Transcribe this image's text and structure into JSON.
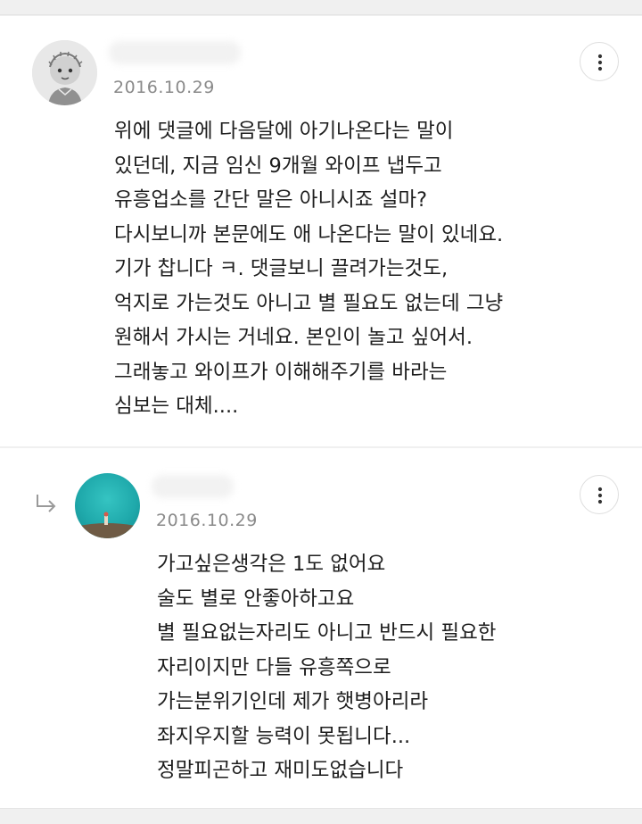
{
  "comments": [
    {
      "date": "2016.10.29",
      "avatar_icon": "character-sketch-avatar-icon",
      "menu_icon": "more-vertical-icon",
      "text": "위에 댓글에 다음달에 아기나온다는 말이\n있던데, 지금 임신 9개월 와이프 냅두고\n유흥업소를 간단 말은 아니시죠 설마?\n다시보니까 본문에도 애 나온다는 말이 있네요.\n기가 찹니다 ㅋ. 댓글보니 끌려가는것도,\n억지로 가는것도 아니고 별 필요도 없는데 그냥\n원해서 가시는 거네요. 본인이 놀고 싶어서.\n그래놓고 와이프가 이해해주기를 바라는\n심보는 대체...."
    },
    {
      "date": "2016.10.29",
      "is_reply": true,
      "reply_icon": "reply-arrow-icon",
      "avatar_icon": "teal-photo-avatar-icon",
      "menu_icon": "more-vertical-icon",
      "text": "가고싶은생각은 1도 없어요\n술도 별로 안좋아하고요\n별 필요없는자리도 아니고 반드시 필요한\n자리이지만 다들 유흥쪽으로\n가는분위기인데 제가 햇병아리라\n좌지우지할 능력이 못됩니다...\n정말피곤하고 재미도없습니다"
    }
  ],
  "colors": {
    "background": "#f0f0f0",
    "card": "#ffffff",
    "text": "#1e1e1e",
    "date": "#8a8a8a",
    "avatar_teal": "#1fa9ab"
  }
}
